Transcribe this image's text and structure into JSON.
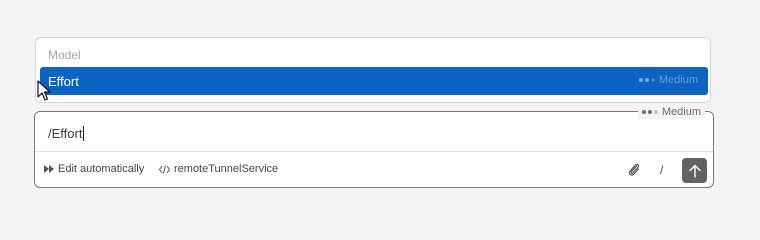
{
  "dropdown": {
    "header": "Model",
    "items": [
      {
        "label": "Effort",
        "level": "Medium",
        "selected": true
      }
    ]
  },
  "chat": {
    "effort_badge": "Medium",
    "input_value": "/Effort",
    "toolbar": {
      "edit_label": "Edit automatically",
      "edit_icon": "fast-forward-icon",
      "tunnel_label": "remoteTunnelService",
      "tunnel_icon": "code-icon",
      "attach_icon": "paperclip-icon",
      "slash_label": "/",
      "send_icon": "arrow-up-icon"
    }
  },
  "colors": {
    "accent": "#0b63c3",
    "send_button": "#626262"
  }
}
